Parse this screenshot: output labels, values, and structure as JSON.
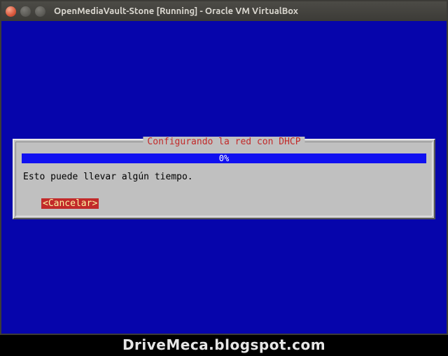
{
  "titlebar": {
    "text": "OpenMediaVault-Stone [Running] - Oracle VM VirtualBox"
  },
  "dialog": {
    "title": "Configurando la red con DHCP",
    "progress_label": "0%",
    "message": "Esto puede llevar algún tiempo.",
    "cancel_label": "<Cancelar>"
  },
  "watermark": "DriveMeca.blogspot.com"
}
